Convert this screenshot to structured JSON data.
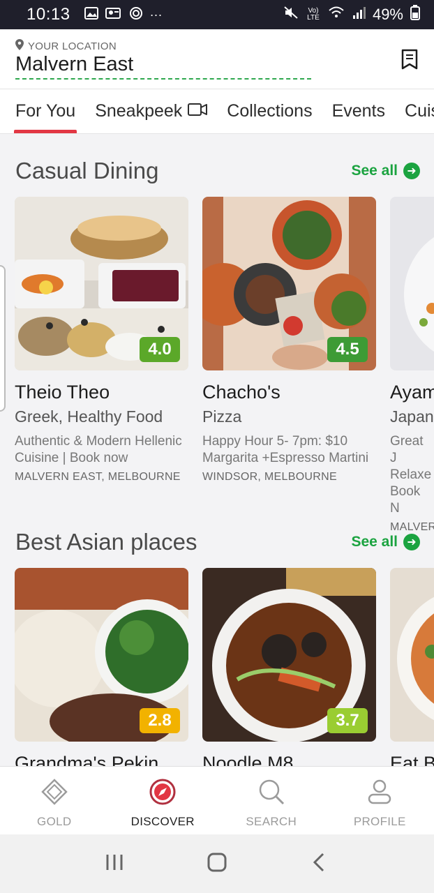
{
  "status_bar": {
    "time": "10:13",
    "battery": "49%",
    "dots": "···",
    "volte": "Vo) LTE"
  },
  "location": {
    "label": "YOUR LOCATION",
    "name": "Malvern East"
  },
  "tabs": [
    "For You",
    "Sneakpeek",
    "Collections",
    "Events",
    "Cuisines"
  ],
  "sections": [
    {
      "title": "Casual Dining",
      "see_all": "See all",
      "cards": [
        {
          "name": "Theio Theo",
          "cuisine": "Greek, Healthy Food",
          "description": "Authentic & Modern Hellenic Cuisine | Book now",
          "location": "MALVERN EAST, MELBOURNE",
          "rating": "4.0",
          "rating_color": "#5ba829"
        },
        {
          "name": "Chacho's",
          "cuisine": "Pizza",
          "description": "Happy Hour 5- 7pm: $10 Margarita +Espresso Martini",
          "location": "WINDSOR, MELBOURNE",
          "rating": "4.5",
          "rating_color": "#3d9b35"
        },
        {
          "name": "Ayam",
          "cuisine": "Japan",
          "description": "Great J Relaxe Book N",
          "location": "MALVER",
          "rating": "",
          "rating_color": "#3d9b35"
        }
      ]
    },
    {
      "title": "Best Asian places",
      "see_all": "See all",
      "cards": [
        {
          "name": "Grandma's Pekin",
          "rating": "2.8",
          "rating_color": "#f2b200"
        },
        {
          "name": "Noodle M8",
          "rating": "3.7",
          "rating_color": "#9acd32"
        },
        {
          "name": "Eat B",
          "rating": "",
          "rating_color": "#9acd32"
        }
      ]
    }
  ],
  "bottom_nav": [
    {
      "label": "GOLD",
      "icon": "gold-diamond-icon"
    },
    {
      "label": "DISCOVER",
      "icon": "compass-icon",
      "active": true
    },
    {
      "label": "SEARCH",
      "icon": "search-icon"
    },
    {
      "label": "PROFILE",
      "icon": "profile-icon"
    }
  ],
  "colors": {
    "accent_red": "#e23744",
    "see_all_green": "#1ba340"
  }
}
